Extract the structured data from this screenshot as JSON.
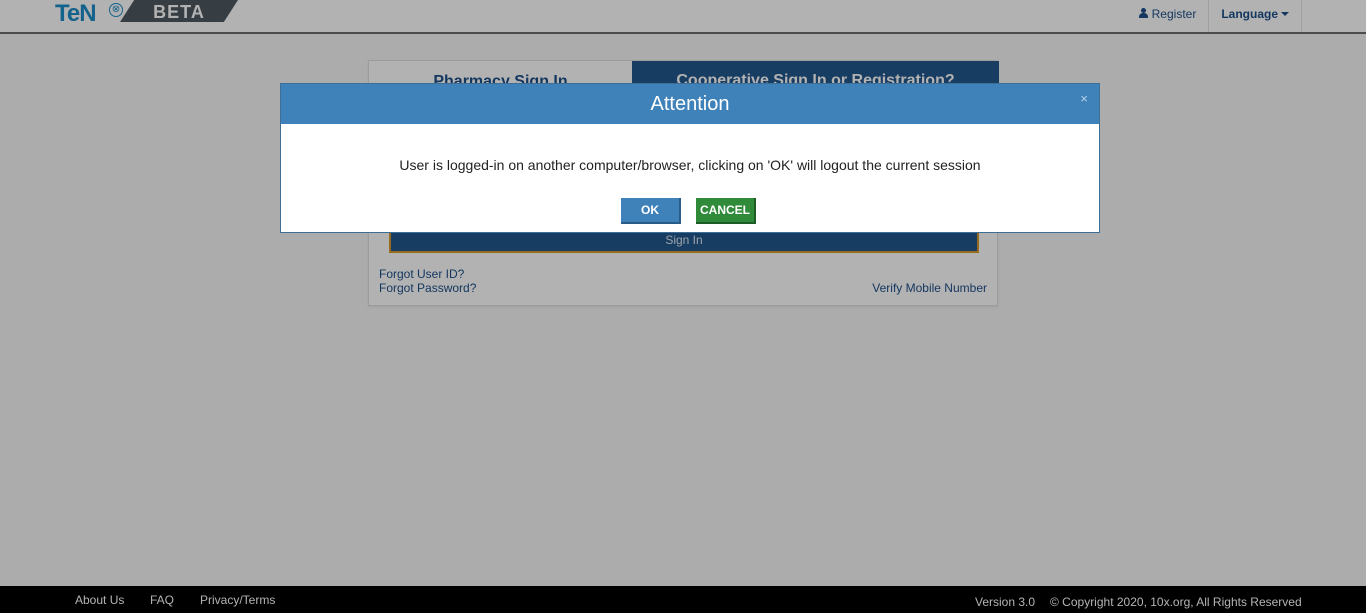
{
  "header": {
    "logo_text": "TeN",
    "logo_symbol": "⊗",
    "beta_label": "BETA",
    "register_label": "Register",
    "language_label": "Language"
  },
  "card": {
    "tab_pharmacy": "Pharmacy Sign In",
    "tab_coop": "Cooperative Sign In or Registration?",
    "signin_label": "Sign In",
    "forgot_user_id": "Forgot User ID?",
    "forgot_password": "Forgot Password?",
    "verify_mobile": "Verify Mobile Number"
  },
  "modal": {
    "title": "Attention",
    "close_symbol": "×",
    "message": "User is logged-in on another computer/browser, clicking on 'OK' will logout the current session",
    "ok_label": "OK",
    "cancel_label": "CANCEL"
  },
  "footer": {
    "about_us": "About Us",
    "faq": "FAQ",
    "privacy_terms": "Privacy/Terms",
    "version": "Version 3.0",
    "copyright": "© Copyright 2020, 10x.org, All Rights Reserved"
  },
  "colors": {
    "modal_header": "#3f82ba",
    "ok_button": "#3f82ba",
    "cancel_button": "#2f8a3a",
    "brand_blue": "#1c8ec9",
    "nav_blue": "#1e4f8a"
  }
}
